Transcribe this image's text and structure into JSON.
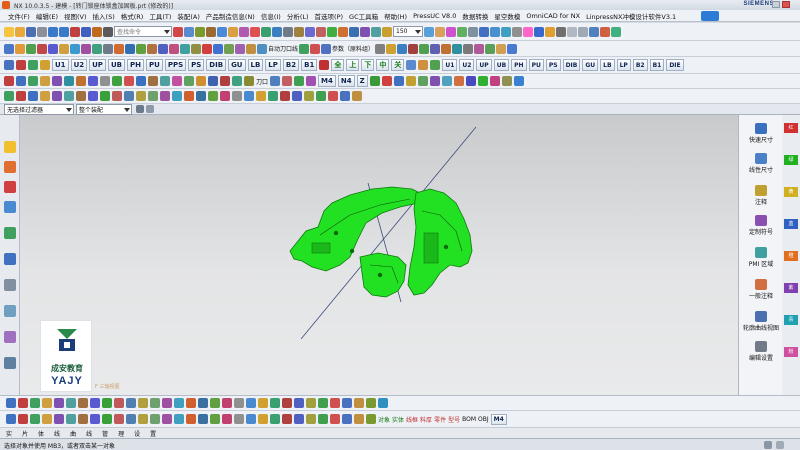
{
  "titlebar": {
    "title": "NX 10.0.3.5 - 建模 - [转门锁座体锁盒加固板.prt (修改的)]",
    "brand": "SIEMENS"
  },
  "menubar": {
    "items": [
      "文件(F)",
      "编辑(E)",
      "视图(V)",
      "插入(S)",
      "格式(R)",
      "工具(T)",
      "装配(A)",
      "产品制造信息(N)",
      "信息(I)",
      "分析(L)",
      "首选项(P)",
      "GC工具箱",
      "帮助(H)",
      "PressUC V8.0",
      "数据转换",
      "星空数模",
      "OmniCAD for NX",
      "LinpressNX冲模设计软件V3.1"
    ]
  },
  "toolbar1": {
    "search_placeholder": "查找命令",
    "layer_value": "150"
  },
  "toolbar2": {
    "labels": [
      "自动刀口线",
      "参数（原料组）"
    ]
  },
  "toolbar3": {
    "buttons": [
      "U1",
      "U2",
      "UP",
      "UB",
      "PH",
      "PU",
      "PPS",
      "PS",
      "DIB",
      "GU",
      "LB",
      "LP",
      "B2",
      "B1",
      "全",
      "上",
      "下",
      "中",
      "关",
      "U1",
      "U2",
      "UP",
      "UB",
      "PH",
      "PU",
      "PS",
      "DIB",
      "GU",
      "LB",
      "LP",
      "B2",
      "B1",
      "DIE"
    ]
  },
  "toolbar4": {
    "buttons": [
      "M4",
      "N4",
      "Z"
    ],
    "label": "刀口"
  },
  "selection": {
    "filter_value": "无选择过滤器",
    "scope_value": "整个装配"
  },
  "viewport": {
    "caption": "F 三轴视图"
  },
  "right_panel": {
    "items": [
      "快速尺寸",
      "线性尺寸",
      "注释",
      "定制符号",
      "PMI 区域",
      "一般注释",
      "轮廓曲线视图",
      "编辑设置"
    ]
  },
  "far_right": {
    "items": [
      "红",
      "绿",
      "黄",
      "蓝",
      "橙",
      "紫",
      "青",
      "粉"
    ]
  },
  "bottom_bar2": {
    "labels": [
      "对象",
      "实体",
      "线框",
      "料厚",
      "零件",
      "型号",
      "BOM",
      "OBJ"
    ]
  },
  "bottom_bar3": {
    "labels": [
      "实",
      "片",
      "体",
      "线",
      "曲",
      "线",
      "管",
      "理",
      "设",
      "置"
    ]
  },
  "logo": {
    "name_cn": "成安教育",
    "name_en": "YAJY"
  },
  "status": {
    "prompt": "选择对象并使用 MB3，或者双击某一对象"
  },
  "colors": {
    "part_green": "#22e022",
    "accent_blue": "#2e7bd6",
    "viewport_top": "#c8cacc",
    "viewport_bottom": "#e9eaeb"
  }
}
